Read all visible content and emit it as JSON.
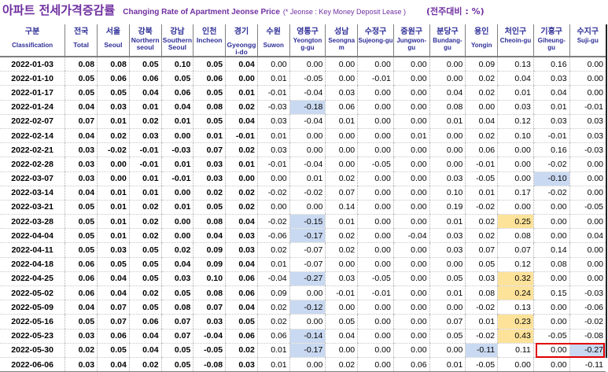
{
  "title": {
    "korean": "아파트 전세가격증감률",
    "english": "Changing Rate of Apartment Jeonse Price",
    "note": "(* Jeonse : Key Money Deposit Lease )",
    "unit": "(전주대비 : %)"
  },
  "columns": [
    {
      "ko": "구분",
      "en": "Classification"
    },
    {
      "ko": "전국",
      "en": "Total"
    },
    {
      "ko": "서울",
      "en": "Seoul"
    },
    {
      "ko": "강북",
      "en": "Northern seoul"
    },
    {
      "ko": "강남",
      "en": "Southern Seoul"
    },
    {
      "ko": "인천",
      "en": "Incheon"
    },
    {
      "ko": "경기",
      "en": "Gyeongg i-do"
    },
    {
      "ko": "수원",
      "en": "Suwon"
    },
    {
      "ko": "영통구",
      "en": "Yeongton g-gu"
    },
    {
      "ko": "성남",
      "en": "Seongna m"
    },
    {
      "ko": "수정구",
      "en": "Sujeong-gu"
    },
    {
      "ko": "중원구",
      "en": "Jungwon-gu"
    },
    {
      "ko": "분당구",
      "en": "Bundang-gu"
    },
    {
      "ko": "용인",
      "en": "Yongin"
    },
    {
      "ko": "처인구",
      "en": "Cheoin-gu"
    },
    {
      "ko": "기흥구",
      "en": "Giheung-gu"
    },
    {
      "ko": "수지구",
      "en": "Suji-gu"
    }
  ],
  "rows": [
    {
      "date": "2022-01-03",
      "v": [
        "0.08",
        "0.08",
        "0.05",
        "0.10",
        "0.05",
        "0.04",
        "0.00",
        "0.00",
        "0.00",
        "0.00",
        "0.00",
        "0.00",
        "0.09",
        "0.13",
        "0.16",
        "0.00"
      ]
    },
    {
      "date": "2022-01-10",
      "v": [
        "0.05",
        "0.06",
        "0.06",
        "0.05",
        "0.06",
        "0.00",
        "0.01",
        "-0.05",
        "0.00",
        "-0.01",
        "0.00",
        "0.00",
        "0.02",
        "0.04",
        "0.03",
        "0.00"
      ]
    },
    {
      "date": "2022-01-17",
      "v": [
        "0.05",
        "0.05",
        "0.04",
        "0.06",
        "0.05",
        "0.01",
        "-0.01",
        "-0.04",
        "0.03",
        "0.00",
        "0.00",
        "0.04",
        "0.02",
        "0.01",
        "0.04",
        "0.00"
      ]
    },
    {
      "date": "2022-01-24",
      "v": [
        "0.04",
        "0.03",
        "0.01",
        "0.04",
        "0.08",
        "0.02",
        "-0.03",
        "-0.18",
        "0.06",
        "0.00",
        "0.00",
        "0.08",
        "0.00",
        "0.03",
        "0.01",
        "-0.01"
      ]
    },
    {
      "date": "2022-02-07",
      "v": [
        "0.07",
        "0.01",
        "0.02",
        "0.01",
        "0.05",
        "0.04",
        "0.03",
        "-0.04",
        "0.01",
        "0.00",
        "0.00",
        "0.01",
        "0.04",
        "0.12",
        "0.03",
        "0.03"
      ]
    },
    {
      "date": "2022-02-14",
      "v": [
        "0.04",
        "0.02",
        "0.03",
        "0.00",
        "0.01",
        "-0.01",
        "0.01",
        "0.00",
        "0.00",
        "0.00",
        "0.01",
        "0.00",
        "0.02",
        "0.10",
        "-0.01",
        "0.03"
      ]
    },
    {
      "date": "2022-02-21",
      "v": [
        "0.03",
        "-0.02",
        "-0.01",
        "-0.03",
        "0.07",
        "0.02",
        "0.03",
        "0.00",
        "0.00",
        "0.00",
        "0.00",
        "0.00",
        "0.06",
        "0.00",
        "0.16",
        "-0.03"
      ]
    },
    {
      "date": "2022-02-28",
      "v": [
        "0.03",
        "0.00",
        "-0.01",
        "0.01",
        "0.03",
        "0.01",
        "-0.01",
        "-0.04",
        "0.00",
        "-0.05",
        "0.00",
        "0.00",
        "-0.01",
        "0.00",
        "-0.02",
        "0.00"
      ]
    },
    {
      "date": "2022-03-07",
      "v": [
        "0.03",
        "0.00",
        "0.01",
        "-0.01",
        "0.03",
        "0.00",
        "0.00",
        "0.01",
        "0.02",
        "0.00",
        "0.00",
        "0.03",
        "-0.05",
        "0.00",
        "-0.10",
        "0.00"
      ]
    },
    {
      "date": "2022-03-14",
      "v": [
        "0.04",
        "0.01",
        "0.01",
        "0.00",
        "0.02",
        "0.02",
        "-0.02",
        "-0.02",
        "0.07",
        "0.00",
        "0.00",
        "0.10",
        "0.01",
        "0.17",
        "-0.02",
        "0.00"
      ]
    },
    {
      "date": "2022-03-21",
      "v": [
        "0.05",
        "0.01",
        "0.02",
        "0.01",
        "0.05",
        "0.02",
        "0.00",
        "0.00",
        "0.14",
        "0.00",
        "0.00",
        "0.19",
        "-0.02",
        "0.00",
        "0.00",
        "-0.05"
      ]
    },
    {
      "date": "2022-03-28",
      "v": [
        "0.05",
        "0.01",
        "0.02",
        "0.00",
        "0.08",
        "0.04",
        "-0.02",
        "-0.15",
        "0.01",
        "0.00",
        "0.00",
        "0.01",
        "0.02",
        "0.25",
        "0.00",
        "0.00"
      ]
    },
    {
      "date": "2022-04-04",
      "v": [
        "0.05",
        "0.01",
        "0.02",
        "0.00",
        "0.04",
        "0.03",
        "-0.06",
        "-0.17",
        "0.02",
        "0.00",
        "-0.04",
        "0.03",
        "0.02",
        "0.08",
        "0.00",
        "0.04"
      ]
    },
    {
      "date": "2022-04-11",
      "v": [
        "0.05",
        "0.03",
        "0.05",
        "0.02",
        "0.09",
        "0.03",
        "0.02",
        "-0.07",
        "0.02",
        "0.00",
        "0.00",
        "0.03",
        "0.07",
        "0.07",
        "0.14",
        "0.00"
      ]
    },
    {
      "date": "2022-04-18",
      "v": [
        "0.06",
        "0.05",
        "0.05",
        "0.04",
        "0.09",
        "0.04",
        "0.01",
        "-0.07",
        "0.00",
        "0.00",
        "0.00",
        "0.00",
        "0.05",
        "0.12",
        "0.08",
        "0.00"
      ]
    },
    {
      "date": "2022-04-25",
      "v": [
        "0.06",
        "0.04",
        "0.05",
        "0.03",
        "0.10",
        "0.06",
        "-0.04",
        "-0.27",
        "0.03",
        "-0.05",
        "0.00",
        "0.05",
        "0.03",
        "0.32",
        "0.00",
        "0.00"
      ]
    },
    {
      "date": "2022-05-02",
      "v": [
        "0.06",
        "0.04",
        "0.02",
        "0.05",
        "0.08",
        "0.06",
        "0.09",
        "0.00",
        "-0.01",
        "-0.01",
        "0.00",
        "0.01",
        "0.08",
        "0.24",
        "0.15",
        "-0.03"
      ]
    },
    {
      "date": "2022-05-09",
      "v": [
        "0.04",
        "0.07",
        "0.05",
        "0.08",
        "0.07",
        "0.04",
        "0.02",
        "-0.12",
        "0.00",
        "0.00",
        "0.00",
        "0.00",
        "-0.02",
        "0.13",
        "0.00",
        "-0.06"
      ]
    },
    {
      "date": "2022-05-16",
      "v": [
        "0.05",
        "0.07",
        "0.06",
        "0.07",
        "0.03",
        "0.05",
        "0.02",
        "0.00",
        "0.05",
        "0.00",
        "0.00",
        "0.07",
        "0.01",
        "0.23",
        "0.00",
        "-0.02"
      ]
    },
    {
      "date": "2022-05-23",
      "v": [
        "0.03",
        "0.06",
        "0.04",
        "0.07",
        "-0.04",
        "0.06",
        "0.06",
        "-0.14",
        "0.04",
        "0.00",
        "0.00",
        "0.05",
        "-0.02",
        "0.43",
        "-0.05",
        "-0.08"
      ]
    },
    {
      "date": "2022-05-30",
      "v": [
        "0.02",
        "0.05",
        "0.04",
        "0.05",
        "-0.05",
        "0.02",
        "0.01",
        "-0.17",
        "0.00",
        "0.00",
        "0.00",
        "0.00",
        "-0.11",
        "0.11",
        "0.00",
        "-0.27"
      ]
    },
    {
      "date": "2022-06-06",
      "v": [
        "0.03",
        "0.04",
        "0.02",
        "0.05",
        "-0.08",
        "0.03",
        "0.01",
        "0.00",
        "0.02",
        "0.00",
        "0.06",
        "0.01",
        "-0.05",
        "0.00",
        "0.00",
        "-0.11"
      ]
    }
  ],
  "highlights": {
    "blue": [
      [
        3,
        7
      ],
      [
        8,
        14
      ],
      [
        11,
        7
      ],
      [
        12,
        7
      ],
      [
        15,
        7
      ],
      [
        17,
        7
      ],
      [
        19,
        7
      ],
      [
        20,
        7
      ],
      [
        20,
        12
      ],
      [
        20,
        15
      ]
    ],
    "yellow": [
      [
        11,
        13
      ],
      [
        15,
        13
      ],
      [
        16,
        13
      ],
      [
        18,
        13
      ],
      [
        19,
        13
      ]
    ]
  },
  "colors": {
    "title": "#7030a0",
    "header": "#2f2f98",
    "blue_cell": "#c9d9f1",
    "yellow_cell": "#fde29a",
    "callout": "#e00000"
  }
}
